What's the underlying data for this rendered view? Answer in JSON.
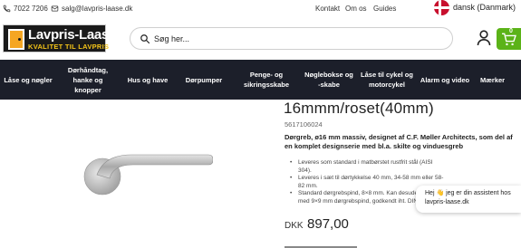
{
  "topbar": {
    "phone": "7022 7206",
    "email": "salg@lavpris-laase.dk",
    "links": [
      "Kontakt",
      "Om os",
      "Guides"
    ],
    "language": "dansk (Danmark)"
  },
  "logo": {
    "name": "Lavpris-Laase",
    "tagline": "KVALITET TIL LAVPRIS"
  },
  "search": {
    "placeholder": "Søg her..."
  },
  "cart": {
    "count": "0"
  },
  "nav": {
    "items": [
      {
        "line1": "Låse og nøgler",
        "line2": "",
        "line3": ""
      },
      {
        "line1": "Dørhåndtag,",
        "line2": "hanke og",
        "line3": "knopper"
      },
      {
        "line1": "Hus og have",
        "line2": "",
        "line3": ""
      },
      {
        "line1": "Dørpumper",
        "line2": "",
        "line3": ""
      },
      {
        "line1": "Penge- og",
        "line2": "sikringsskabe",
        "line3": ""
      },
      {
        "line1": "Nøglebokse og",
        "line2": "-skabe",
        "line3": ""
      },
      {
        "line1": "Låse til cykel og",
        "line2": "motorcykel",
        "line3": ""
      },
      {
        "line1": "Alarm og video",
        "line2": "",
        "line3": ""
      },
      {
        "line1": "Mærker",
        "line2": "",
        "line3": ""
      }
    ]
  },
  "product": {
    "title": "16mmm/roset(40mm)",
    "sku": "5617106024",
    "description": "Dørgreb, ø16 mm massiv, designet af C.F. Møller Architects, som del af en komplet designserie med bl.a. skilte og vinduesgreb",
    "bullets": [
      "Leveres som standard i matbørstet rustfrit stål (AISI 304).",
      "Leveres i sæt til dørtykkelse 40 mm, 34-58 mm eller 58-82 mm.",
      "Standard dørgrebspind, 8×8 mm. Kan desuden leveres med 9×9 mm dørgrebspind, godkendt iht. DIN 18273."
    ],
    "price_currency": "DKK",
    "price_amount": "897,00"
  },
  "chat": {
    "message": "Hej 👋 jeg er din assistent hos lavpris-laase.dk"
  },
  "colors": {
    "nav_bg": "#1c1f2a",
    "cart_green": "#5bb318",
    "logo_bg": "#1a1a1a",
    "logo_accent": "#f5c518"
  }
}
